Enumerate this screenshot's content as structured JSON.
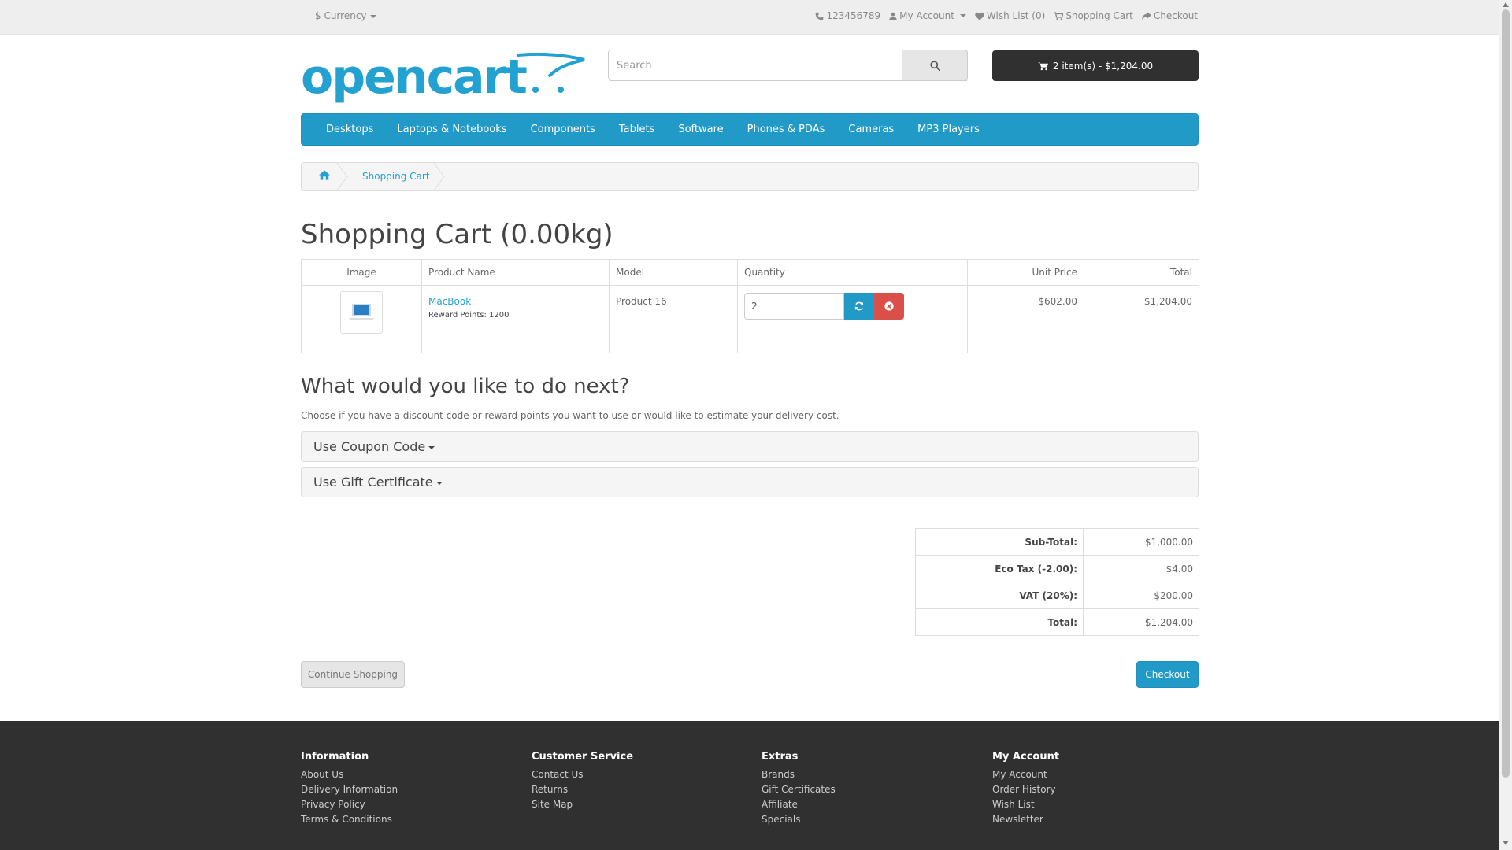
{
  "topbar": {
    "currency": "$ Currency",
    "phone": "123456789",
    "my_account": "My Account",
    "wishlist": "Wish List (0)",
    "shopping_cart": "Shopping Cart",
    "checkout": "Checkout"
  },
  "header": {
    "logo_text": "opencart",
    "search_placeholder": "Search",
    "cart_button": "2 item(s) - $1,204.00"
  },
  "menu": [
    "Desktops",
    "Laptops & Notebooks",
    "Components",
    "Tablets",
    "Software",
    "Phones & PDAs",
    "Cameras",
    "MP3 Players"
  ],
  "breadcrumb": {
    "current": "Shopping Cart"
  },
  "page_title": "Shopping Cart  (0.00kg)",
  "cart": {
    "headers": {
      "image": "Image",
      "name": "Product Name",
      "model": "Model",
      "quantity": "Quantity",
      "unit_price": "Unit Price",
      "total": "Total"
    },
    "rows": [
      {
        "name": "MacBook",
        "reward": "Reward Points: 1200",
        "model": "Product 16",
        "quantity": "2",
        "unit_price": "$602.00",
        "total": "$1,204.00"
      }
    ]
  },
  "next": {
    "title": "What would you like to do next?",
    "description": "Choose if you have a discount code or reward points you want to use or would like to estimate your delivery cost.",
    "coupon": "Use Coupon Code",
    "gift": "Use Gift Certificate"
  },
  "totals": [
    {
      "label": "Sub-Total:",
      "value": "$1,000.00"
    },
    {
      "label": "Eco Tax (-2.00):",
      "value": "$4.00"
    },
    {
      "label": "VAT (20%):",
      "value": "$200.00"
    },
    {
      "label": "Total:",
      "value": "$1,204.00"
    }
  ],
  "buttons": {
    "continue": "Continue Shopping",
    "checkout": "Checkout"
  },
  "footer": {
    "information": {
      "title": "Information",
      "links": [
        "About Us",
        "Delivery Information",
        "Privacy Policy",
        "Terms & Conditions"
      ]
    },
    "customer_service": {
      "title": "Customer Service",
      "links": [
        "Contact Us",
        "Returns",
        "Site Map"
      ]
    },
    "extras": {
      "title": "Extras",
      "links": [
        "Brands",
        "Gift Certificates",
        "Affiliate",
        "Specials"
      ]
    },
    "my_account": {
      "title": "My Account",
      "links": [
        "My Account",
        "Order History",
        "Wish List",
        "Newsletter"
      ]
    }
  },
  "colors": {
    "accent": "#229ac8",
    "dark": "#303030",
    "danger": "#da4f49",
    "link": "#23a1d1"
  }
}
